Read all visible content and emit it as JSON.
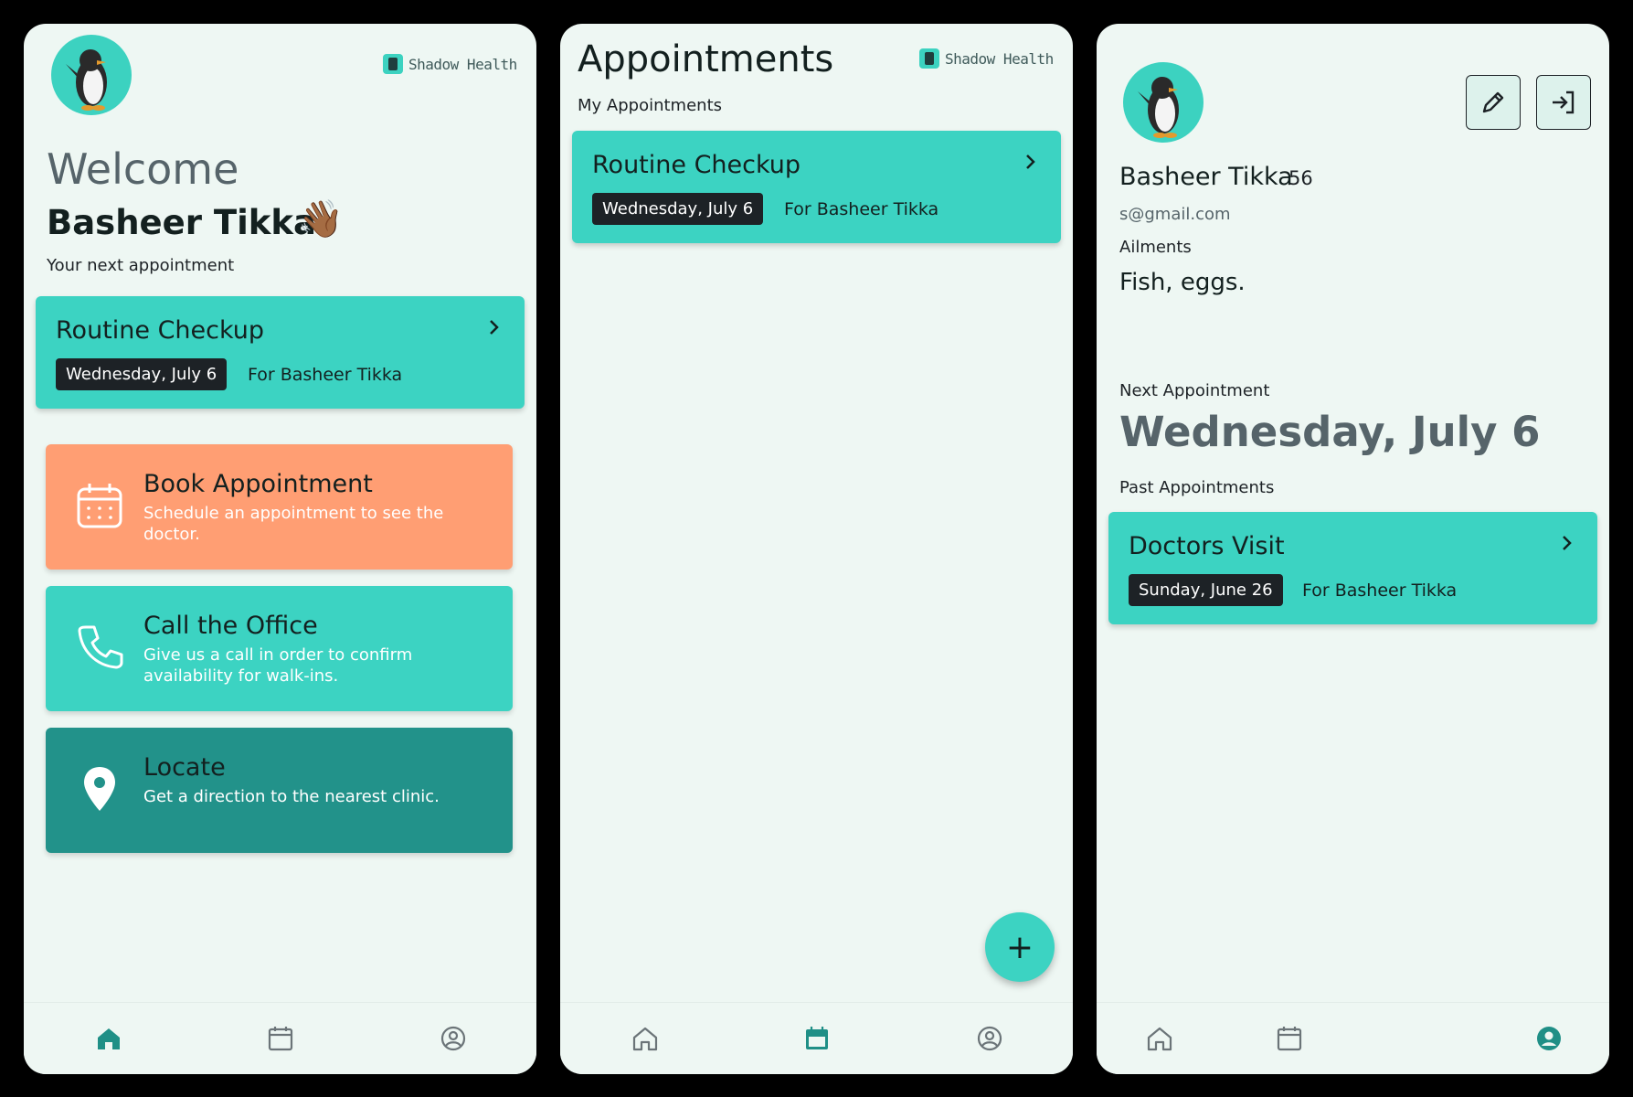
{
  "brand": "Shadow Health",
  "home": {
    "welcome": "Welcome",
    "user_name": "Basheer Tikka",
    "wave": "👋🏾",
    "next_label": "Your next appointment",
    "next_appt": {
      "title": "Routine Checkup",
      "date": "Wednesday, July 6",
      "for": "For Basheer Tikka"
    },
    "actions": [
      {
        "title": "Book Appointment",
        "desc": "Schedule an appointment to see the doctor.",
        "color": "#ff9e73",
        "icon": "calendar-icon"
      },
      {
        "title": "Call the Office",
        "desc": "Give us a call in order to confirm availability for walk-ins.",
        "color": "#3cd3c2",
        "icon": "phone-icon"
      },
      {
        "title": "Locate",
        "desc": "Get a direction to the nearest clinic.",
        "color": "#22928a",
        "icon": "location-pin-icon"
      }
    ]
  },
  "appointments": {
    "title": "Appointments",
    "subtitle": "My Appointments",
    "items": [
      {
        "title": "Routine Checkup",
        "date": "Wednesday, July 6",
        "for": "For Basheer Tikka"
      }
    ],
    "fab": "+"
  },
  "profile": {
    "name": "Basheer Tikka",
    "age": "56",
    "email": "s@gmail.com",
    "ailments_label": "Ailments",
    "ailments": "Fish, eggs.",
    "next_label": "Next Appointment",
    "next_date": "Wednesday, July 6",
    "past_label": "Past Appointments",
    "past": [
      {
        "title": "Doctors Visit",
        "date": "Sunday, June 26",
        "for": "For Basheer Tikka"
      }
    ]
  },
  "nav": [
    "home-icon",
    "calendar-icon",
    "profile-icon"
  ],
  "colors": {
    "teal": "#3cd3c2",
    "dark_teal": "#22928a",
    "orange": "#ff9e73",
    "bg": "#eef7f3",
    "active": "#1f8f86"
  }
}
